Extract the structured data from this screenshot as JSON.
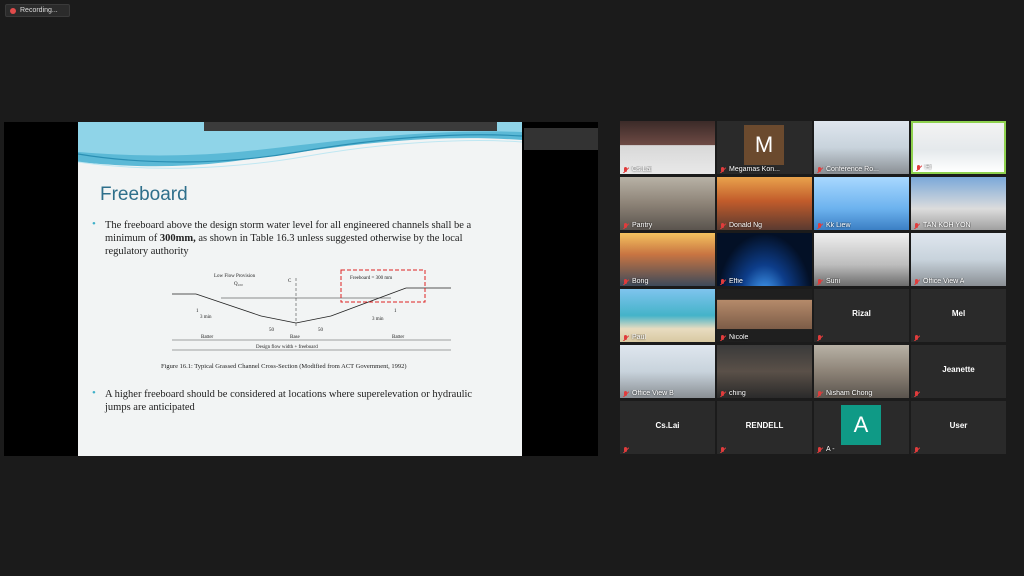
{
  "recording": {
    "label": "Recording..."
  },
  "slide": {
    "title": "Freeboard",
    "bullet1_part1": "The freeboard above the design storm water level for all engineered channels shall be a minimum of ",
    "bullet1_bold": "300mm,",
    "bullet1_part2": " as shown in Table 16.3 unless suggested otherwise by the local regulatory authority",
    "bullet2": "A higher freeboard should be considered at locations where superelevation or hydraulic jumps are anticipated",
    "caption": "Figure 16.1:  Typical Grassed Channel Cross-Section (Modified from ACT Government, 1992)",
    "figure": {
      "low_flow": "Low Flow Provision",
      "q": "Q₁₀₀",
      "cl": "C",
      "freeboard_label": "Freeboard = 300 mm",
      "ratio_one": "1",
      "ratio_three": "3 min",
      "fifty": "50",
      "batter": "Batter",
      "base": "Base",
      "design_width": "Design flow width + freeboard"
    }
  },
  "participants": [
    {
      "name": "Cs.Lai",
      "kind": "video",
      "scene": "person"
    },
    {
      "name": "Megamas Kon...",
      "kind": "avatar",
      "letter": "M",
      "color": "#6b4a2e"
    },
    {
      "name": "Conference Ro...",
      "kind": "video",
      "scene": "office"
    },
    {
      "name": "Hi",
      "kind": "video",
      "scene": "woman",
      "active": true
    },
    {
      "name": "Pantry",
      "kind": "video",
      "scene": "room"
    },
    {
      "name": "Donald Ng",
      "kind": "video",
      "scene": "bridge"
    },
    {
      "name": "Kk Liew",
      "kind": "video",
      "scene": "smurfs"
    },
    {
      "name": "TAN KOH YON",
      "kind": "video",
      "scene": "man"
    },
    {
      "name": "Bong",
      "kind": "video",
      "scene": "sunset"
    },
    {
      "name": "Effie",
      "kind": "video",
      "scene": "earth"
    },
    {
      "name": "Suni",
      "kind": "video",
      "scene": "ceiling"
    },
    {
      "name": "Office View A",
      "kind": "video",
      "scene": "office"
    },
    {
      "name": "Paul",
      "kind": "video",
      "scene": "beach"
    },
    {
      "name": "Nicole",
      "kind": "video",
      "scene": "shelf"
    },
    {
      "name": "Rizal",
      "kind": "name"
    },
    {
      "name": "Mel",
      "kind": "name"
    },
    {
      "name": "Office View B",
      "kind": "video",
      "scene": "office"
    },
    {
      "name": "ching",
      "kind": "video",
      "scene": "dark"
    },
    {
      "name": "Nisham Chong",
      "kind": "video",
      "scene": "room"
    },
    {
      "name": "Jeanette",
      "kind": "name"
    },
    {
      "name": "Cs.Lai",
      "kind": "name"
    },
    {
      "name": "RENDELL",
      "kind": "name"
    },
    {
      "name": "A -",
      "kind": "avatar",
      "letter": "A",
      "color": "#0f9a86"
    },
    {
      "name": "User",
      "kind": "name"
    }
  ]
}
